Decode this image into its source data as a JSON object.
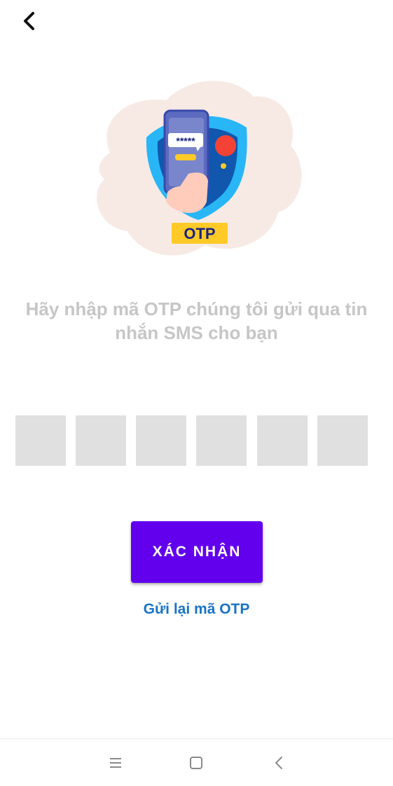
{
  "header": {
    "back_icon": "chevron-left-icon"
  },
  "illustration": {
    "badge_label": "OTP",
    "masked_code": "*****",
    "colors": {
      "shield": "#29b6f6",
      "phone": "#3f51b5",
      "badge": "#ffca28",
      "notification_dot": "#f44336",
      "blob": "#f7eae5"
    }
  },
  "instruction_text": "Hãy nhập mã OTP chúng tôi gửi qua tin nhắn SMS cho bạn",
  "otp": {
    "digits": [
      "",
      "",
      "",
      "",
      "",
      ""
    ]
  },
  "confirm_label": "XÁC NHẬN",
  "resend_label": "Gửi lại mã OTP",
  "colors": {
    "primary": "#6200ee",
    "link": "#1a73c8",
    "instruction_text": "#c6c6c6",
    "otp_box": "#e0e0e0"
  },
  "nav_bar": {
    "items": [
      "menu-icon",
      "home-icon",
      "back-icon"
    ]
  }
}
